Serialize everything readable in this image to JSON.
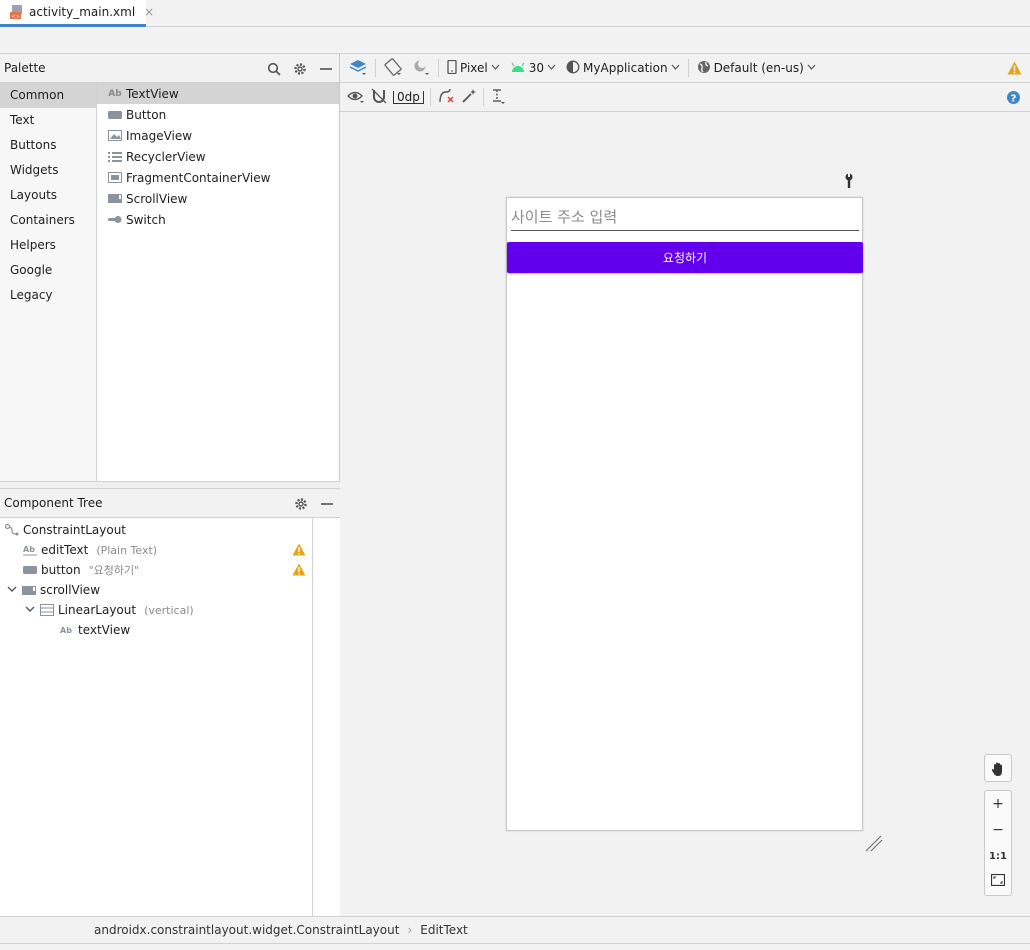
{
  "tab": {
    "label": "activity_main.xml",
    "close": "×"
  },
  "palette": {
    "title": "Palette",
    "categories": [
      "Common",
      "Text",
      "Buttons",
      "Widgets",
      "Layouts",
      "Containers",
      "Helpers",
      "Google",
      "Legacy"
    ],
    "selected_category": "Common",
    "items": [
      {
        "label": "TextView",
        "icon": "Ab"
      },
      {
        "label": "Button",
        "icon": "button-icon"
      },
      {
        "label": "ImageView",
        "icon": "image-icon"
      },
      {
        "label": "RecyclerView",
        "icon": "list-icon"
      },
      {
        "label": "FragmentContainerView",
        "icon": "fragment-icon"
      },
      {
        "label": "ScrollView",
        "icon": "scroll-icon"
      },
      {
        "label": "Switch",
        "icon": "switch-icon"
      }
    ]
  },
  "component_tree": {
    "title": "Component Tree",
    "nodes": [
      {
        "label": "ConstraintLayout",
        "meta": ""
      },
      {
        "label": "editText",
        "meta": "(Plain Text)"
      },
      {
        "label": "button",
        "meta": "\"요청하기\""
      },
      {
        "label": "scrollView",
        "meta": ""
      },
      {
        "label": "LinearLayout",
        "meta": "(vertical)"
      },
      {
        "label": "textView",
        "meta": ""
      }
    ]
  },
  "design_toolbar": {
    "device": "Pixel",
    "api": "30",
    "theme": "MyApplication",
    "locale": "Default (en-us)",
    "margin": "0dp"
  },
  "preview": {
    "edit_hint": "사이트 주소 입력",
    "button_label": "요청하기",
    "button_color": "#6200ee"
  },
  "zoom": {
    "plus": "+",
    "minus": "−",
    "one_to_one": "1:1"
  },
  "status": {
    "path1": "androidx.constraintlayout.widget.ConstraintLayout",
    "sep": "›",
    "path2": "EditText"
  }
}
